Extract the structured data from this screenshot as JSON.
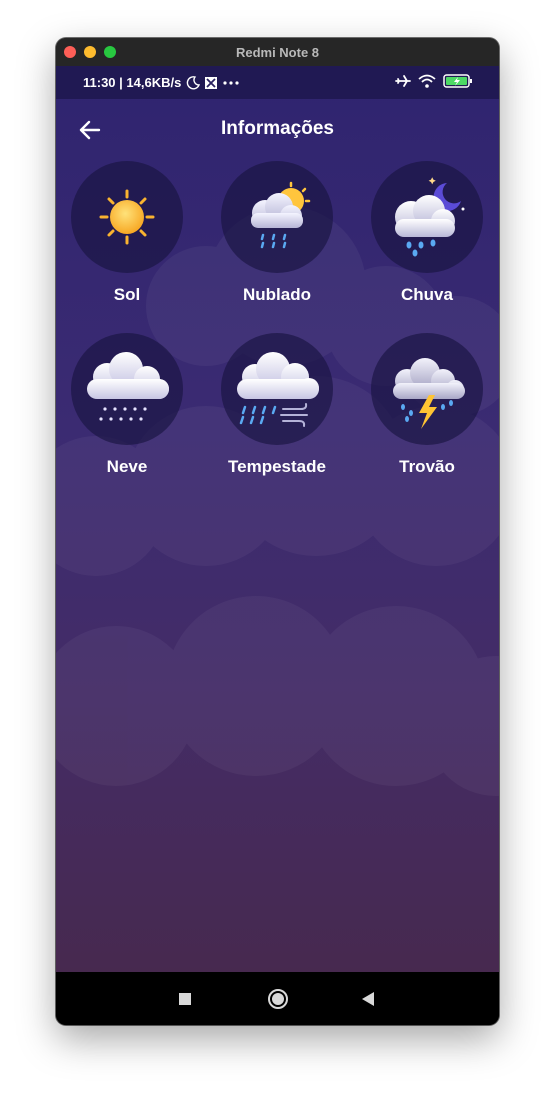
{
  "window": {
    "title": "Redmi Note 8"
  },
  "status_bar": {
    "time": "11:30 | 14,6KB/s"
  },
  "header": {
    "title": "Informações"
  },
  "weather_items": [
    {
      "label": "Sol",
      "icon": "sun-icon"
    },
    {
      "label": "Nublado",
      "icon": "cloud-sun-rain-icon"
    },
    {
      "label": "Chuva",
      "icon": "cloud-moon-rain-icon"
    },
    {
      "label": "Neve",
      "icon": "snow-cloud-icon"
    },
    {
      "label": "Tempestade",
      "icon": "storm-wind-icon"
    },
    {
      "label": "Trovão",
      "icon": "thunder-cloud-icon"
    }
  ],
  "colors": {
    "background_top": "#2f2470",
    "background_bottom": "#47294f",
    "circle": "#19143f",
    "text": "#ffffff"
  }
}
